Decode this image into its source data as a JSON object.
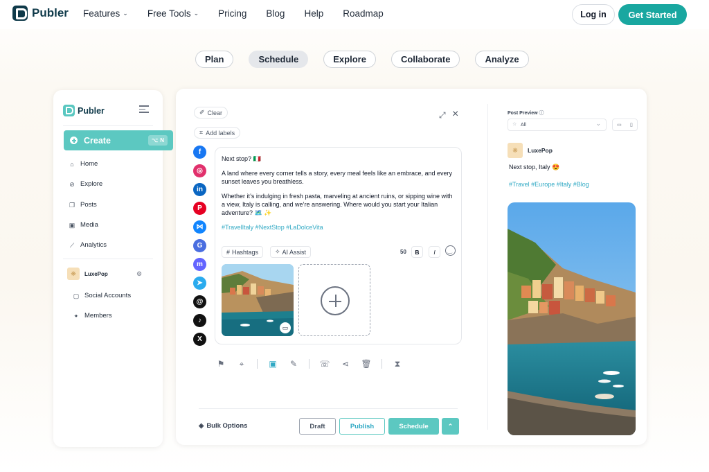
{
  "brand": {
    "name": "Publer"
  },
  "nav": {
    "links": [
      {
        "label": "Features",
        "has_caret": true
      },
      {
        "label": "Free Tools",
        "has_caret": true
      },
      {
        "label": "Pricing"
      },
      {
        "label": "Blog"
      },
      {
        "label": "Help"
      },
      {
        "label": "Roadmap"
      }
    ],
    "login": "Log in",
    "get_started": "Get Started"
  },
  "feature_tabs": [
    "Plan",
    "Schedule",
    "Explore",
    "Collaborate",
    "Analyze"
  ],
  "active_feature_tab": "Schedule",
  "sidebar": {
    "brand": "Publer",
    "create": {
      "label": "Create",
      "shortcut": "N",
      "shortcut_icon": "command-icon"
    },
    "items": [
      {
        "label": "Home",
        "icon": "home-icon"
      },
      {
        "label": "Explore",
        "icon": "compass-icon"
      },
      {
        "label": "Posts",
        "icon": "posts-icon"
      },
      {
        "label": "Media",
        "icon": "image-icon"
      },
      {
        "label": "Analytics",
        "icon": "chart-icon"
      }
    ],
    "workspace": "LuxePop",
    "workspace_items": [
      {
        "label": "Social Accounts",
        "icon": "accounts-icon"
      },
      {
        "label": "Members",
        "icon": "members-icon"
      }
    ]
  },
  "editor": {
    "clear": "Clear",
    "add_labels": "Add labels",
    "social_networks": [
      {
        "name": "facebook",
        "glyph": "f",
        "color": "#1877f2"
      },
      {
        "name": "instagram",
        "glyph": "◎",
        "color": "#e1306c"
      },
      {
        "name": "linkedin",
        "glyph": "in",
        "color": "#0a66c2"
      },
      {
        "name": "pinterest",
        "glyph": "P",
        "color": "#e60023"
      },
      {
        "name": "bluesky",
        "glyph": "⋈",
        "color": "#1185fe"
      },
      {
        "name": "google-business",
        "glyph": "G",
        "color": "#4a6ee0"
      },
      {
        "name": "mastodon",
        "glyph": "m",
        "color": "#6364ff"
      },
      {
        "name": "telegram",
        "glyph": "➤",
        "color": "#2aabee"
      },
      {
        "name": "threads",
        "glyph": "@",
        "color": "#111111"
      },
      {
        "name": "tiktok",
        "glyph": "♪",
        "color": "#111111"
      },
      {
        "name": "x",
        "glyph": "X",
        "color": "#111111"
      }
    ],
    "post": {
      "line1": "Next stop? 🇮🇹",
      "line2": "A land where every corner tells a story, every meal feels like an embrace, and every sunset leaves you breathless.",
      "line3": "Whether it’s indulging in fresh pasta, marveling at ancient ruins, or sipping wine with a view, Italy is calling, and we’re answering. Where would you start your Italian adventure? 🗺️ ✨",
      "hashtags": "#TravelItaly #NextStop #LaDolceVita"
    },
    "tools": {
      "hashtags": "Hashtags",
      "ai_assist": "AI Assist",
      "char_count": "50",
      "bold": "B",
      "italic": "I"
    },
    "bulk_options": "Bulk Options",
    "buttons": {
      "draft": "Draft",
      "publish": "Publish",
      "schedule": "Schedule"
    }
  },
  "preview": {
    "label": "Post Preview",
    "filter": "All",
    "account": "LuxePop",
    "caption": "Next stop, Italy 😍",
    "tags": "#Travel #Europe #Italy #Blog"
  },
  "colors": {
    "accent": "#5cc8c1",
    "brand_dark": "#0f3a4a",
    "cta": "#19a7a0",
    "hashtag": "#30a9c4"
  }
}
